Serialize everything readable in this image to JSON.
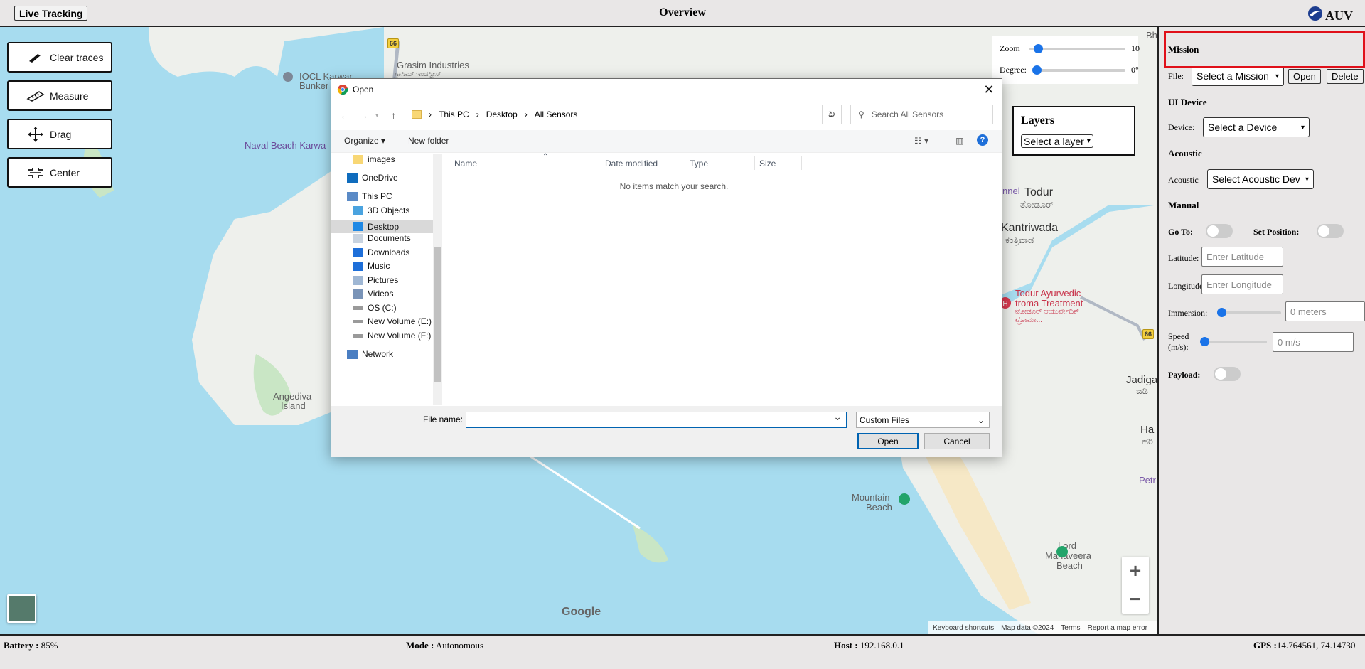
{
  "header": {
    "live_tracking_label": "Live Tracking",
    "title": "Overview",
    "logo_text": "AUV"
  },
  "map": {
    "tools": [
      {
        "label": "Clear traces",
        "icon": "eraser-icon"
      },
      {
        "label": "Measure",
        "icon": "ruler-icon"
      },
      {
        "label": "Drag",
        "icon": "move-icon"
      },
      {
        "label": "Center",
        "icon": "center-icon"
      }
    ],
    "zoom_label": "Zoom",
    "zoom_value": "10",
    "zoom_level": 0.05,
    "degree_label": "Degree:",
    "degree_value": "0°",
    "degree_level": 0.0,
    "layers_title": "Layers",
    "layers_select": "Select a layer",
    "labels": {
      "grasim": "Grasim Industries",
      "grasim_kn": "ಗ್ರಾಸಿಮ್ ಇಂಡಸ್ಟ್ರೀಸ್",
      "iocl": "IOCL Karwar",
      "bunker": "Bunker",
      "naval": "Naval Beach Karwa",
      "angediva": "Angediva",
      "island": "Island",
      "todur": "Todur",
      "todur_kn": "ತೋಡೂರ್",
      "kantriwada": "Kantriwada",
      "kantriwada_kn": "ಕಂತ್ರಿವಾಡ",
      "ayurvedic1": "Todur Ayurvedic",
      "ayurvedic2": "troma Treatment",
      "ayurvedic3": "ಟೋಡೂರ್ ಆಯುರ್ವೇದಿಕ್",
      "ayurvedic4": "ಟ್ರೋಮಾ...",
      "jadiga": "Jadiga",
      "jadiga_kn": "ಜಡಿ",
      "ha": "Ha",
      "ha_kn": "ಹರಿ",
      "petr": "Petr",
      "mountain1": "Mountain",
      "mountain2": "Beach",
      "lord1": "Lord",
      "lord2": "Mahaveera",
      "lord3": "Beach",
      "nnel": "nnel",
      "bh": "Bh",
      "road66": "66"
    },
    "google": "Google",
    "attribution": [
      "Keyboard shortcuts",
      "Map data ©2024",
      "Terms",
      "Report a map error"
    ]
  },
  "panel": {
    "mission_heading": "Mission",
    "file_label": "File:",
    "mission_select": "Select a Mission",
    "open_label": "Open",
    "delete_label": "Delete",
    "ui_device_heading": "UI Device",
    "device_label": "Device:",
    "device_select": "Select a Device",
    "acoustic_heading": "Acoustic",
    "acoustic_label": "Acoustic",
    "acoustic_select": "Select Acoustic Dev",
    "manual_heading": "Manual",
    "goto_label": "Go To:",
    "setpos_label": "Set Position:",
    "latitude_label": "Latitude:",
    "latitude_placeholder": "Enter Latitude",
    "longitude_label": "Longitude:",
    "longitude_placeholder": "Enter Longitude",
    "immersion_label": "Immersion:",
    "immersion_placeholder": "0 meters",
    "speed_label_1": "Speed",
    "speed_label_2": "(m/s):",
    "speed_placeholder": "0 m/s",
    "payload_label": "Payload:",
    "highlight_color": "#e0101a"
  },
  "footer": {
    "battery_label": "Battery :",
    "battery_value": " 85%",
    "mode_label": "Mode :",
    "mode_value": " Autonomous",
    "host_label": "Host :",
    "host_value": " 192.168.0.1",
    "gps_label": "GPS :",
    "gps_value": "14.764561, 74.14730"
  },
  "dialog": {
    "title": "Open",
    "breadcrumb": [
      "This PC",
      "Desktop",
      "All Sensors"
    ],
    "search_placeholder": "Search All Sensors",
    "organize": "Organize",
    "new_folder": "New folder",
    "nav_items": [
      {
        "label": "images",
        "icon": "folder-icon"
      },
      {
        "label": "OneDrive",
        "icon": "cloud-icon"
      },
      {
        "label": "This PC",
        "icon": "computer-icon"
      },
      {
        "label": "3D Objects",
        "icon": "cube-icon"
      },
      {
        "label": "Desktop",
        "icon": "desktop-icon"
      },
      {
        "label": "Documents",
        "icon": "document-icon"
      },
      {
        "label": "Downloads",
        "icon": "download-icon"
      },
      {
        "label": "Music",
        "icon": "music-icon"
      },
      {
        "label": "Pictures",
        "icon": "picture-icon"
      },
      {
        "label": "Videos",
        "icon": "video-icon"
      },
      {
        "label": "OS (C:)",
        "icon": "drive-icon"
      },
      {
        "label": "New Volume (E:)",
        "icon": "drive-icon"
      },
      {
        "label": "New Volume (F:)",
        "icon": "drive-icon"
      },
      {
        "label": "Network",
        "icon": "network-icon"
      }
    ],
    "columns": [
      "Name",
      "Date modified",
      "Type",
      "Size"
    ],
    "empty_message": "No items match your search.",
    "file_name_label": "File name:",
    "file_type": "Custom Files",
    "open_button": "Open",
    "cancel_button": "Cancel"
  }
}
